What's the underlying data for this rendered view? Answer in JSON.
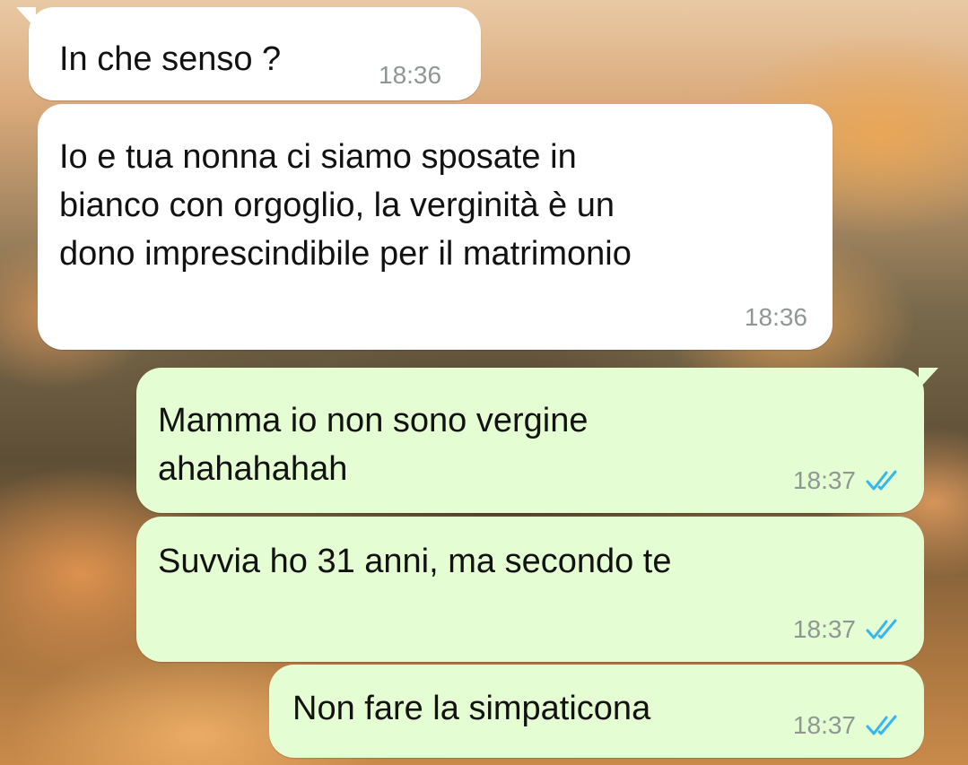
{
  "colors": {
    "incoming_bubble": "#ffffff",
    "outgoing_bubble": "#e5fdd3",
    "timestamp": "#8f9795",
    "read_ticks": "#34b7f1"
  },
  "messages": [
    {
      "direction": "incoming",
      "text": "In che senso ?",
      "time": "18:36"
    },
    {
      "direction": "incoming",
      "text": "Io e tua nonna ci siamo sposate in\nbianco con orgoglio, la verginità è un\ndono imprescindibile per il matrimonio",
      "time": "18:36"
    },
    {
      "direction": "outgoing",
      "text": "Mamma io non sono vergine\nahahahahah",
      "time": "18:37",
      "status_icon": "double-check-read-icon"
    },
    {
      "direction": "outgoing",
      "text": "Suvvia ho 31 anni, ma secondo te",
      "time": "18:37",
      "status_icon": "double-check-read-icon"
    },
    {
      "direction": "outgoing",
      "text": "Non fare la simpaticona",
      "time": "18:37",
      "status_icon": "double-check-read-icon"
    }
  ]
}
